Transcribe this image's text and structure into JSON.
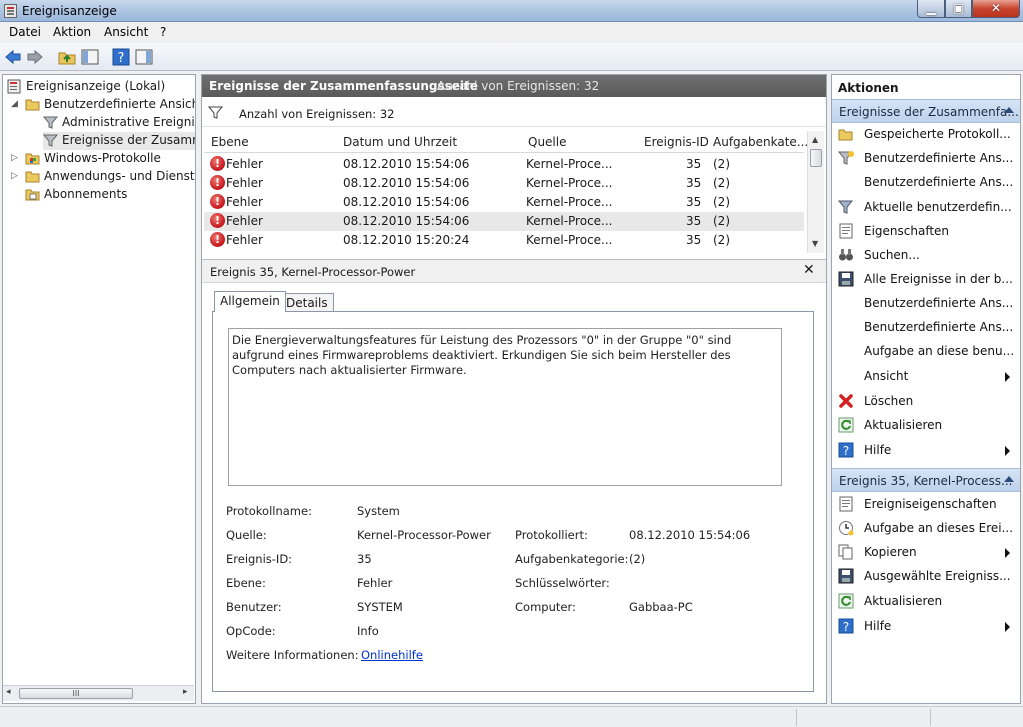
{
  "window": {
    "title": "Ereignisanzeige"
  },
  "menu": [
    "Datei",
    "Aktion",
    "Ansicht",
    "?"
  ],
  "tree": {
    "items": [
      {
        "label": "Ereignisanzeige (Lokal)"
      },
      {
        "label": "Benutzerdefinierte Ansichten"
      },
      {
        "label": "Administrative Ereignisse"
      },
      {
        "label": "Ereignisse der Zusammenfassungsseite"
      },
      {
        "label": "Windows-Protokolle"
      },
      {
        "label": "Anwendungs- und Dienstprotokolle"
      },
      {
        "label": "Abonnements"
      }
    ],
    "scroll_grip": "III"
  },
  "center": {
    "header_title": "Ereignisse der Zusammenfassungsseite",
    "header_count": "Anzahl von Ereignissen: 32",
    "filter_text": "Anzahl von Ereignissen: 32",
    "columns": [
      "Ebene",
      "Datum und Uhrzeit",
      "Quelle",
      "Ereignis-ID",
      "Aufgabenkate..."
    ],
    "rows": [
      {
        "level": "Fehler",
        "date": "08.12.2010 15:54:06",
        "source": "Kernel-Proce...",
        "id": "35",
        "task": "(2)"
      },
      {
        "level": "Fehler",
        "date": "08.12.2010 15:54:06",
        "source": "Kernel-Proce...",
        "id": "35",
        "task": "(2)"
      },
      {
        "level": "Fehler",
        "date": "08.12.2010 15:54:06",
        "source": "Kernel-Proce...",
        "id": "35",
        "task": "(2)"
      },
      {
        "level": "Fehler",
        "date": "08.12.2010 15:54:06",
        "source": "Kernel-Proce...",
        "id": "35",
        "task": "(2)"
      },
      {
        "level": "Fehler",
        "date": "08.12.2010 15:20:24",
        "source": "Kernel-Proce...",
        "id": "35",
        "task": "(2)"
      }
    ],
    "detail_title": "Ereignis 35, Kernel-Processor-Power",
    "tabs": [
      "Allgemein",
      "Details"
    ],
    "message": "Die Energieverwaltungsfeatures für Leistung des Prozessors \"0\" in der Gruppe \"0\" sind aufgrund eines Firmwareproblems deaktiviert. Erkundigen Sie sich beim Hersteller des Computers nach aktualisierter Firmware.",
    "fields": {
      "protokollname_label": "Protokollname:",
      "protokollname": "System",
      "quelle_label": "Quelle:",
      "quelle": "Kernel-Processor-Power",
      "protokolliert_label": "Protokolliert:",
      "protokolliert": "08.12.2010 15:54:06",
      "ereignisid_label": "Ereignis-ID:",
      "ereignisid": "35",
      "aufgabenkategorie_label": "Aufgabenkategorie:",
      "aufgabenkategorie": "(2)",
      "ebene_label": "Ebene:",
      "ebene": "Fehler",
      "schluesselwoerter_label": "Schlüsselwörter:",
      "schluesselwoerter": "",
      "benutzer_label": "Benutzer:",
      "benutzer": "SYSTEM",
      "computer_label": "Computer:",
      "computer": "Gabbaa-PC",
      "opcode_label": "OpCode:",
      "opcode": "Info",
      "weitere_label": "Weitere Informationen:",
      "weitere_link": "Onlinehilfe"
    }
  },
  "actions": {
    "title": "Aktionen",
    "section1": "Ereignisse der Zusammenfa...",
    "items1": [
      "Gespeicherte Protokoll...",
      "Benutzerdefinierte Ans...",
      "Benutzerdefinierte Ans...",
      "Aktuelle benutzerdefin...",
      "Eigenschaften",
      "Suchen...",
      "Alle Ereignisse in der b...",
      "Benutzerdefinierte Ans...",
      "Benutzerdefinierte Ans...",
      "Aufgabe an diese benu...",
      "Ansicht",
      "Löschen",
      "Aktualisieren",
      "Hilfe"
    ],
    "section2": "Ereignis 35, Kernel-Process...",
    "items2": [
      "Ereigniseigenschaften",
      "Aufgabe an dieses Erei...",
      "Kopieren",
      "Ausgewählte Ereigniss...",
      "Aktualisieren",
      "Hilfe"
    ]
  }
}
